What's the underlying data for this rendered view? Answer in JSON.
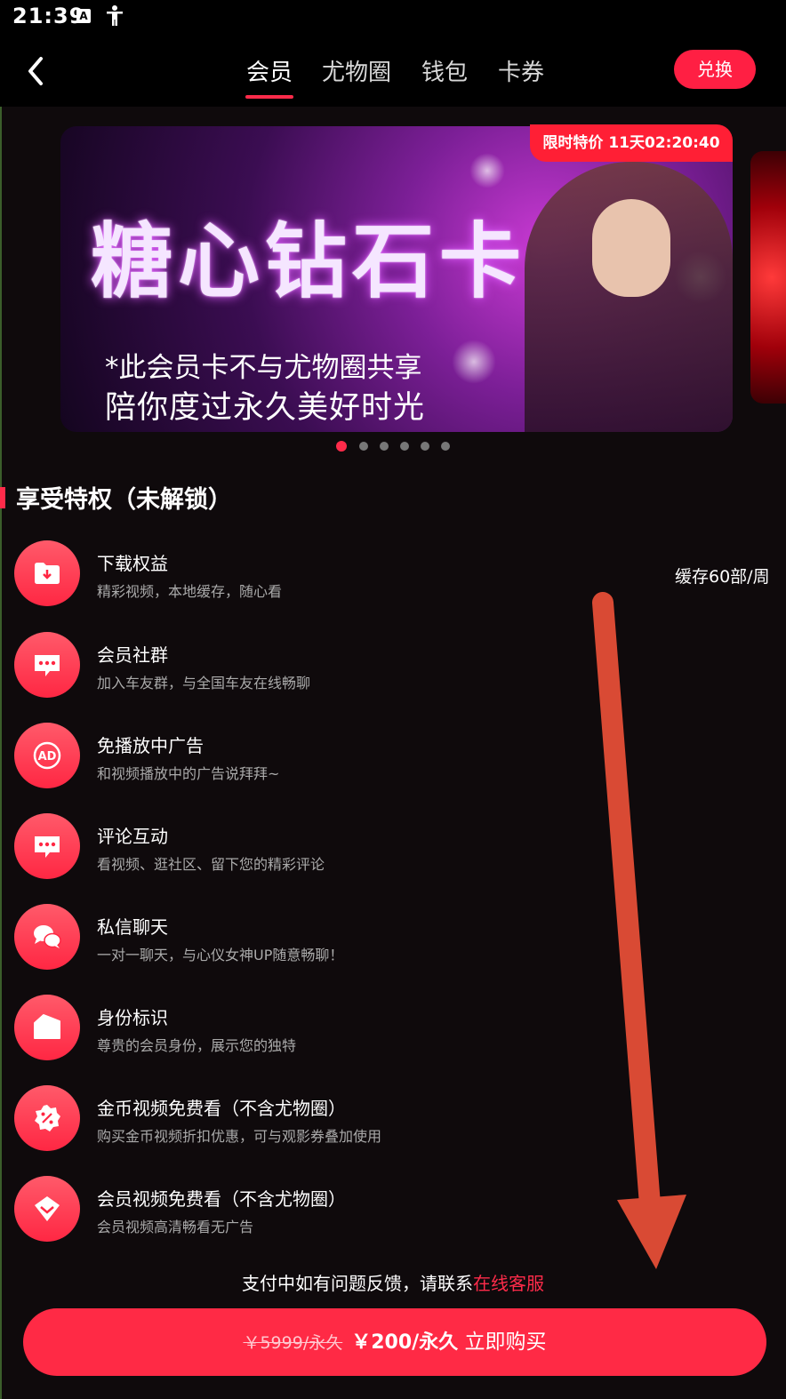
{
  "status_bar": {
    "time": "21:39",
    "icon_a": "A"
  },
  "nav": {
    "tabs": [
      {
        "label": "会员",
        "active": true
      },
      {
        "label": "尤物圈",
        "active": false
      },
      {
        "label": "钱包",
        "active": false
      },
      {
        "label": "卡券",
        "active": false
      }
    ],
    "redeem_label": "兑换"
  },
  "banner": {
    "title": "糖心钻石卡",
    "sub1": "*此会员卡不与尤物圈共享",
    "sub2": "陪你度过永久美好时光",
    "limit_tag": "限时特价 11天02:20:40",
    "dots_count": 6,
    "active_dot": 0
  },
  "section_title": "享受特权（未解锁）",
  "privileges": [
    {
      "icon": "download-folder-icon",
      "title": "下载权益",
      "desc": "精彩视频，本地缓存，随心看",
      "extra": "缓存60部/周"
    },
    {
      "icon": "chat-bubble-icon",
      "title": "会员社群",
      "desc": "加入车友群，与全国车友在线畅聊"
    },
    {
      "icon": "no-ad-icon",
      "title": "免播放中广告",
      "desc": "和视频播放中的广告说拜拜~"
    },
    {
      "icon": "comment-icon",
      "title": "评论互动",
      "desc": "看视频、逛社区、留下您的精彩评论"
    },
    {
      "icon": "private-message-icon",
      "title": "私信聊天",
      "desc": "一对一聊天，与心仪女神UP随意畅聊！"
    },
    {
      "icon": "identity-tag-icon",
      "title": "身份标识",
      "desc": "尊贵的会员身份，展示您的独特"
    },
    {
      "icon": "discount-coin-icon",
      "title": "金币视频免费看（不含尤物圈）",
      "desc": "购买金币视频折扣优惠，可与观影券叠加使用"
    },
    {
      "icon": "diamond-icon",
      "title": "会员视频免费看（不含尤物圈）",
      "desc": "会员视频高清畅看无广告"
    }
  ],
  "help": {
    "text": "支付中如有问题反馈，请联系",
    "link": "在线客服"
  },
  "buy": {
    "original": "￥5999/永久",
    "price": "￥200/永久",
    "action": "立即购买"
  },
  "colors": {
    "accent": "#ff2a45",
    "background": "#0f0a0c",
    "annotation_arrow": "#d94a34"
  }
}
